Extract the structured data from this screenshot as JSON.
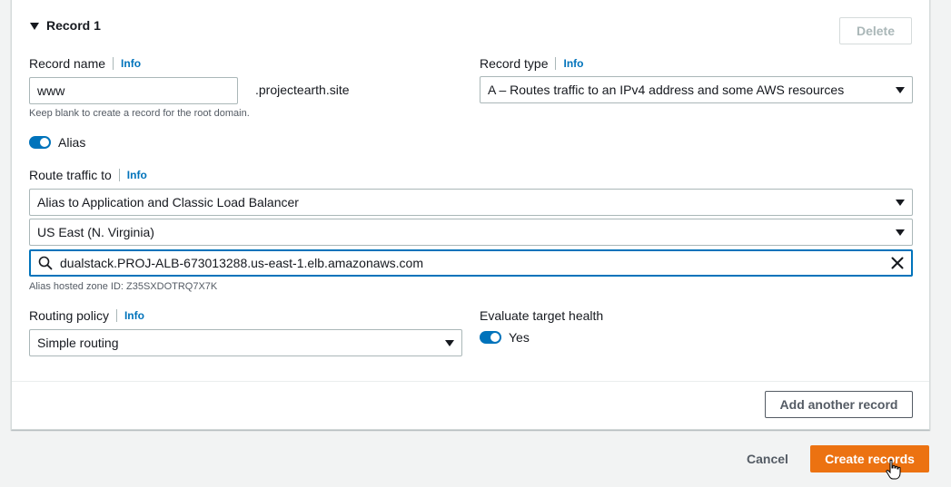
{
  "record": {
    "title": "Record 1",
    "delete_label": "Delete"
  },
  "record_name": {
    "label": "Record name",
    "info": "Info",
    "value": "www",
    "suffix": ".projectearth.site",
    "hint": "Keep blank to create a record for the root domain."
  },
  "record_type": {
    "label": "Record type",
    "info": "Info",
    "value": "A – Routes traffic to an IPv4 address and some AWS resources"
  },
  "alias": {
    "label": "Alias",
    "enabled": true
  },
  "route_traffic": {
    "label": "Route traffic to",
    "info": "Info",
    "endpoint": "Alias to Application and Classic Load Balancer",
    "region": "US East (N. Virginia)",
    "search_value": "dualstack.PROJ-ALB-673013288.us-east-1.elb.amazonaws.com",
    "zone_hint": "Alias hosted zone ID: Z35SXDOTRQ7X7K"
  },
  "routing_policy": {
    "label": "Routing policy",
    "info": "Info",
    "value": "Simple routing"
  },
  "evaluate_health": {
    "label": "Evaluate target health",
    "toggle_label": "Yes",
    "enabled": true
  },
  "actions": {
    "add_another": "Add another record",
    "cancel": "Cancel",
    "create": "Create records"
  },
  "colors": {
    "primary": "#ec7211",
    "link": "#0073bb",
    "toggle_on": "#0073bb"
  }
}
